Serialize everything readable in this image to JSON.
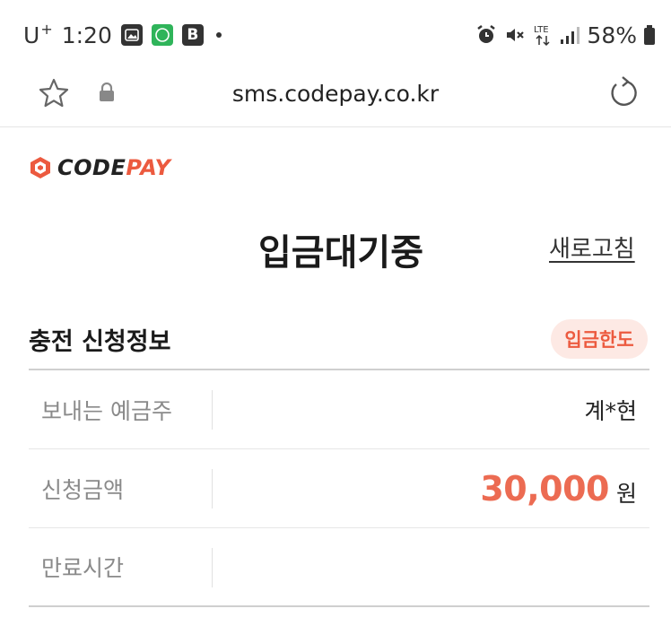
{
  "status_bar": {
    "carrier": "U",
    "carrier_sup": "+",
    "time": "1:20",
    "icons": [
      "gallery-icon",
      "app-icon",
      "b-app-icon",
      "notification-dot"
    ],
    "right_icons": [
      "alarm-icon",
      "mute-icon",
      "lte-icon",
      "signal-icon",
      "battery-icon"
    ],
    "network": "LTE",
    "battery": "58%"
  },
  "browser": {
    "url": "sms.codepay.co.kr"
  },
  "page": {
    "logo": {
      "part1": "CODE",
      "part2": "PAY"
    },
    "title": "입금대기중",
    "refresh_label": "새로고침",
    "section_title": "충전 신청정보",
    "limit_badge": "입금한도",
    "rows": [
      {
        "label": "보내는 예금주",
        "value": "계*현"
      },
      {
        "label": "신청금액",
        "amount": "30,000",
        "unit": "원"
      },
      {
        "label": "만료시간",
        "value": ""
      }
    ]
  },
  "colors": {
    "accent": "#ec5a3f",
    "amount": "#ec6b52",
    "badge_bg": "#fde9e4"
  }
}
